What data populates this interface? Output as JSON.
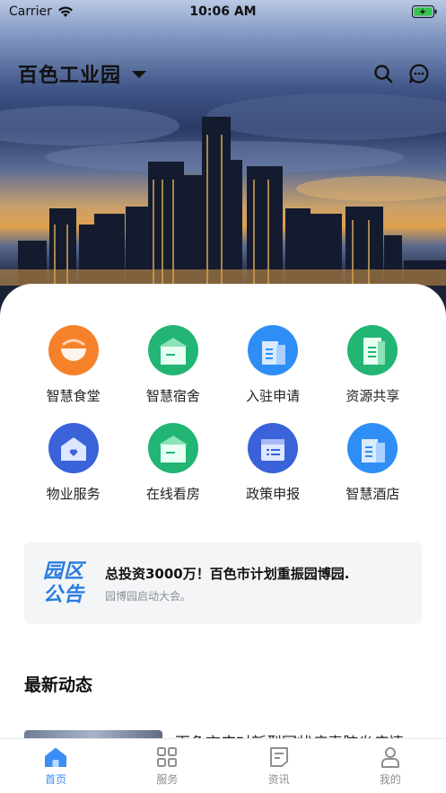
{
  "status_bar": {
    "carrier": "Carrier",
    "time": "10:06 AM"
  },
  "header": {
    "title": "百色工业园"
  },
  "services": [
    {
      "label": "智慧食堂",
      "icon": "canteen-icon",
      "color": "#f5822a"
    },
    {
      "label": "智慧宿舍",
      "icon": "dormitory-icon",
      "color": "#22b573"
    },
    {
      "label": "入驻申请",
      "icon": "settle-apply-icon",
      "color": "#2f8ef5"
    },
    {
      "label": "资源共享",
      "icon": "resource-share-icon",
      "color": "#22b573"
    },
    {
      "label": "物业服务",
      "icon": "property-service-icon",
      "color": "#3a62d9"
    },
    {
      "label": "在线看房",
      "icon": "online-viewing-icon",
      "color": "#22b573"
    },
    {
      "label": "政策申报",
      "icon": "policy-declare-icon",
      "color": "#3a62d9"
    },
    {
      "label": "智慧酒店",
      "icon": "hotel-icon",
      "color": "#2f8ef5"
    }
  ],
  "notice": {
    "badge_line1": "园区",
    "badge_line2": "公告",
    "headline": "总投资3000万！百色市计划重振园博园.",
    "sub": "园博园启动大会。"
  },
  "latest": {
    "title": "最新动态",
    "first_item_title": "百色市应对新型冠状病毒肺炎疫情"
  },
  "tabbar": [
    {
      "label": "首页",
      "icon": "home-icon",
      "active": true
    },
    {
      "label": "服务",
      "icon": "grid-icon",
      "active": false
    },
    {
      "label": "资讯",
      "icon": "news-icon",
      "active": false
    },
    {
      "label": "我的",
      "icon": "user-icon",
      "active": false
    }
  ],
  "colors": {
    "accent": "#3a8ef6",
    "notice_badge": "#2a7de1"
  }
}
